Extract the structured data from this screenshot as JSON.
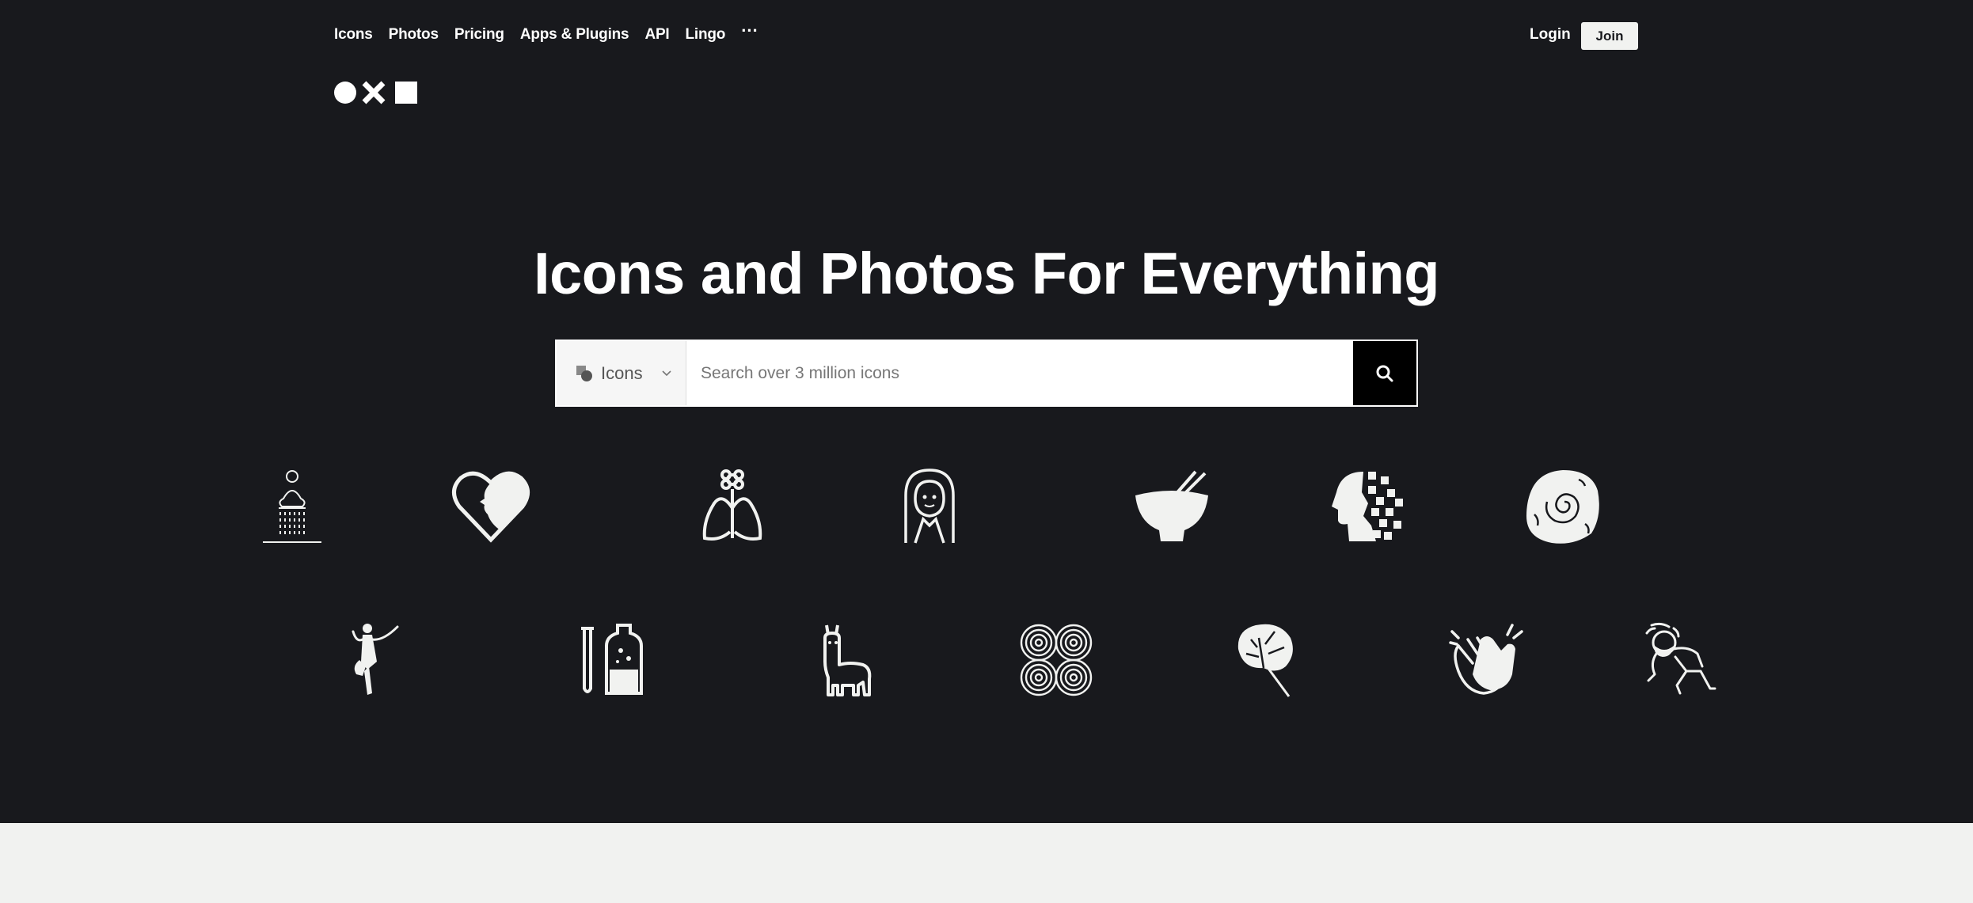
{
  "nav": {
    "items": [
      "Icons",
      "Photos",
      "Pricing",
      "Apps & Plugins",
      "API",
      "Lingo"
    ],
    "more": "···",
    "login": "Login",
    "join": "Join"
  },
  "hero": {
    "headline": "Icons and Photos For Everything"
  },
  "search": {
    "type_label": "Icons",
    "placeholder": "Search over 3 million icons"
  },
  "colors": {
    "hero_bg": "#18191d",
    "page_bg": "#f1f2f0",
    "icon_color": "#f1f2f0"
  },
  "icons_row1": [
    "meditation-shower-icon",
    "heart-face-icon",
    "lungs-flower-icon",
    "hooded-woman-icon",
    "bowl-chopsticks-icon",
    "pixel-head-icon",
    "fossil-stone-icon"
  ],
  "icons_row2": [
    "dancer-icon",
    "test-tube-bottle-icon",
    "llama-icon",
    "swirl-pattern-icon",
    "monstera-leaf-icon",
    "clapping-hands-icon",
    "kid-playing-icon"
  ]
}
